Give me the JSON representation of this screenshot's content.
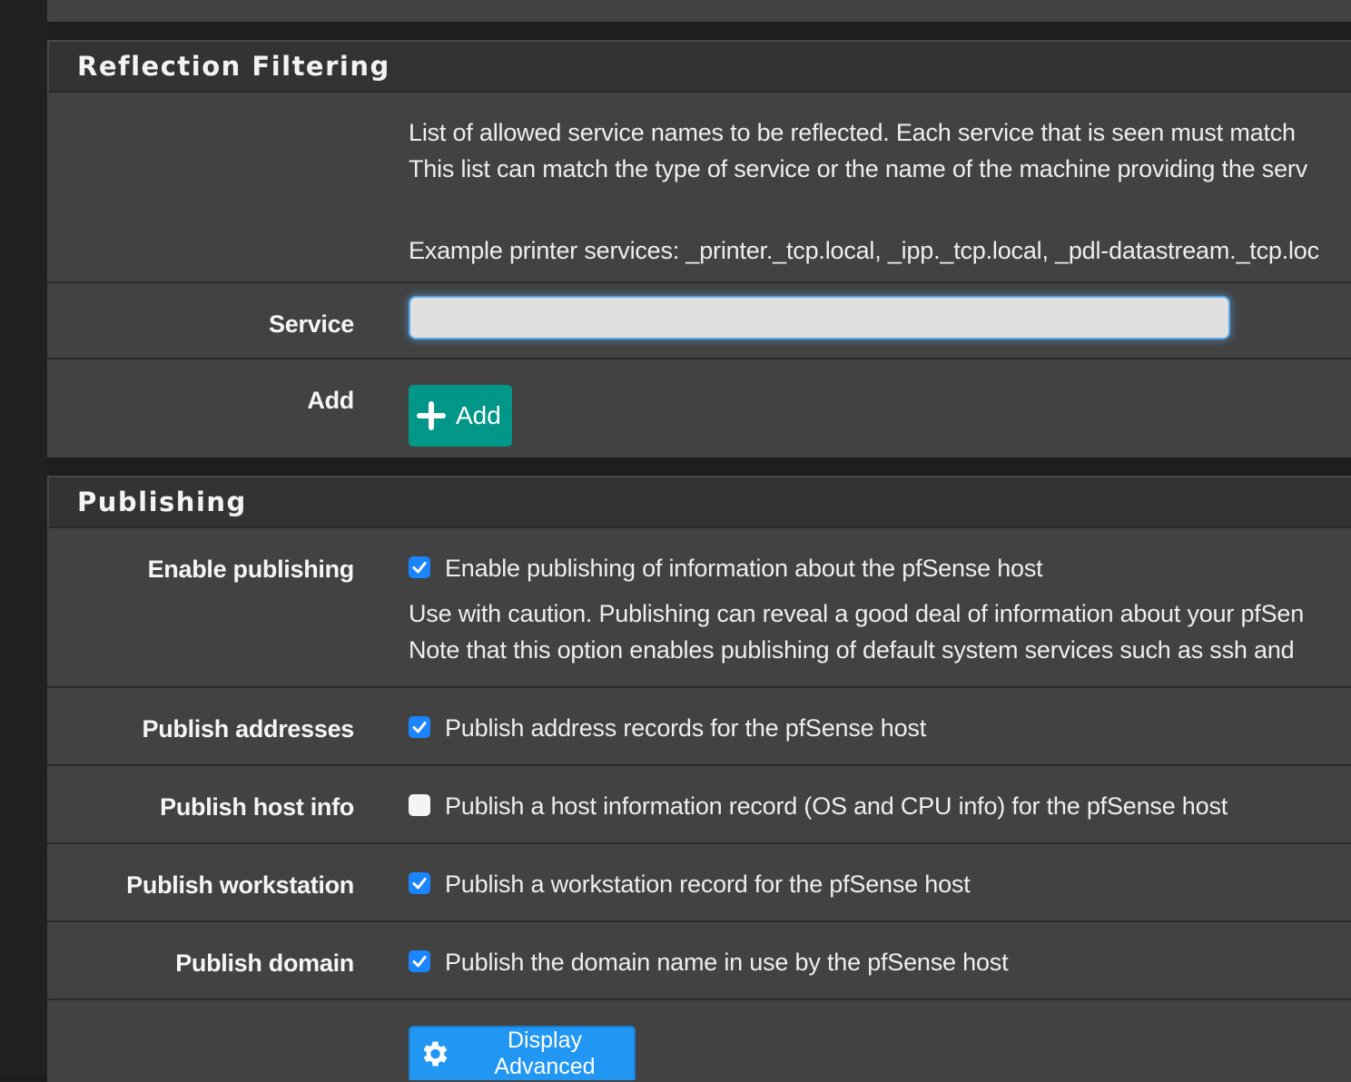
{
  "reflection": {
    "title": "Reflection Filtering",
    "help_lines": [
      "List of allowed service names to be reflected. Each service that is seen must match",
      "This list can match the type of service or the name of the machine providing the serv",
      "",
      "Example printer services: _printer._tcp.local, _ipp._tcp.local, _pdl-datastream._tcp.loc"
    ],
    "service": {
      "label": "Service",
      "value": "",
      "placeholder": ""
    },
    "add": {
      "label": "Add",
      "button_label": "Add",
      "icon": "plus-icon",
      "color": "#009688"
    }
  },
  "publishing": {
    "title": "Publishing",
    "rows": [
      {
        "label": "Enable publishing",
        "checked": true,
        "text": "Enable publishing of information about the pfSense host",
        "help": [
          "Use with caution. Publishing can reveal a good deal of information about your pfSen",
          "Note that this option enables publishing of default system services such as ssh and"
        ]
      },
      {
        "label": "Publish addresses",
        "checked": true,
        "text": "Publish address records for the pfSense host"
      },
      {
        "label": "Publish host info",
        "checked": false,
        "text": "Publish a host information record (OS and CPU info) for the pfSense host"
      },
      {
        "label": "Publish workstation",
        "checked": true,
        "text": "Publish a workstation record for the pfSense host"
      },
      {
        "label": "Publish domain",
        "checked": true,
        "text": "Publish the domain name in use by the pfSense host"
      }
    ],
    "advanced_button": {
      "label": "Display Advanced",
      "icon": "gear-icon",
      "color": "#2196f3"
    }
  },
  "colors": {
    "checkbox_on": "#1a85ff",
    "input_focus": "#5aa6e8"
  }
}
